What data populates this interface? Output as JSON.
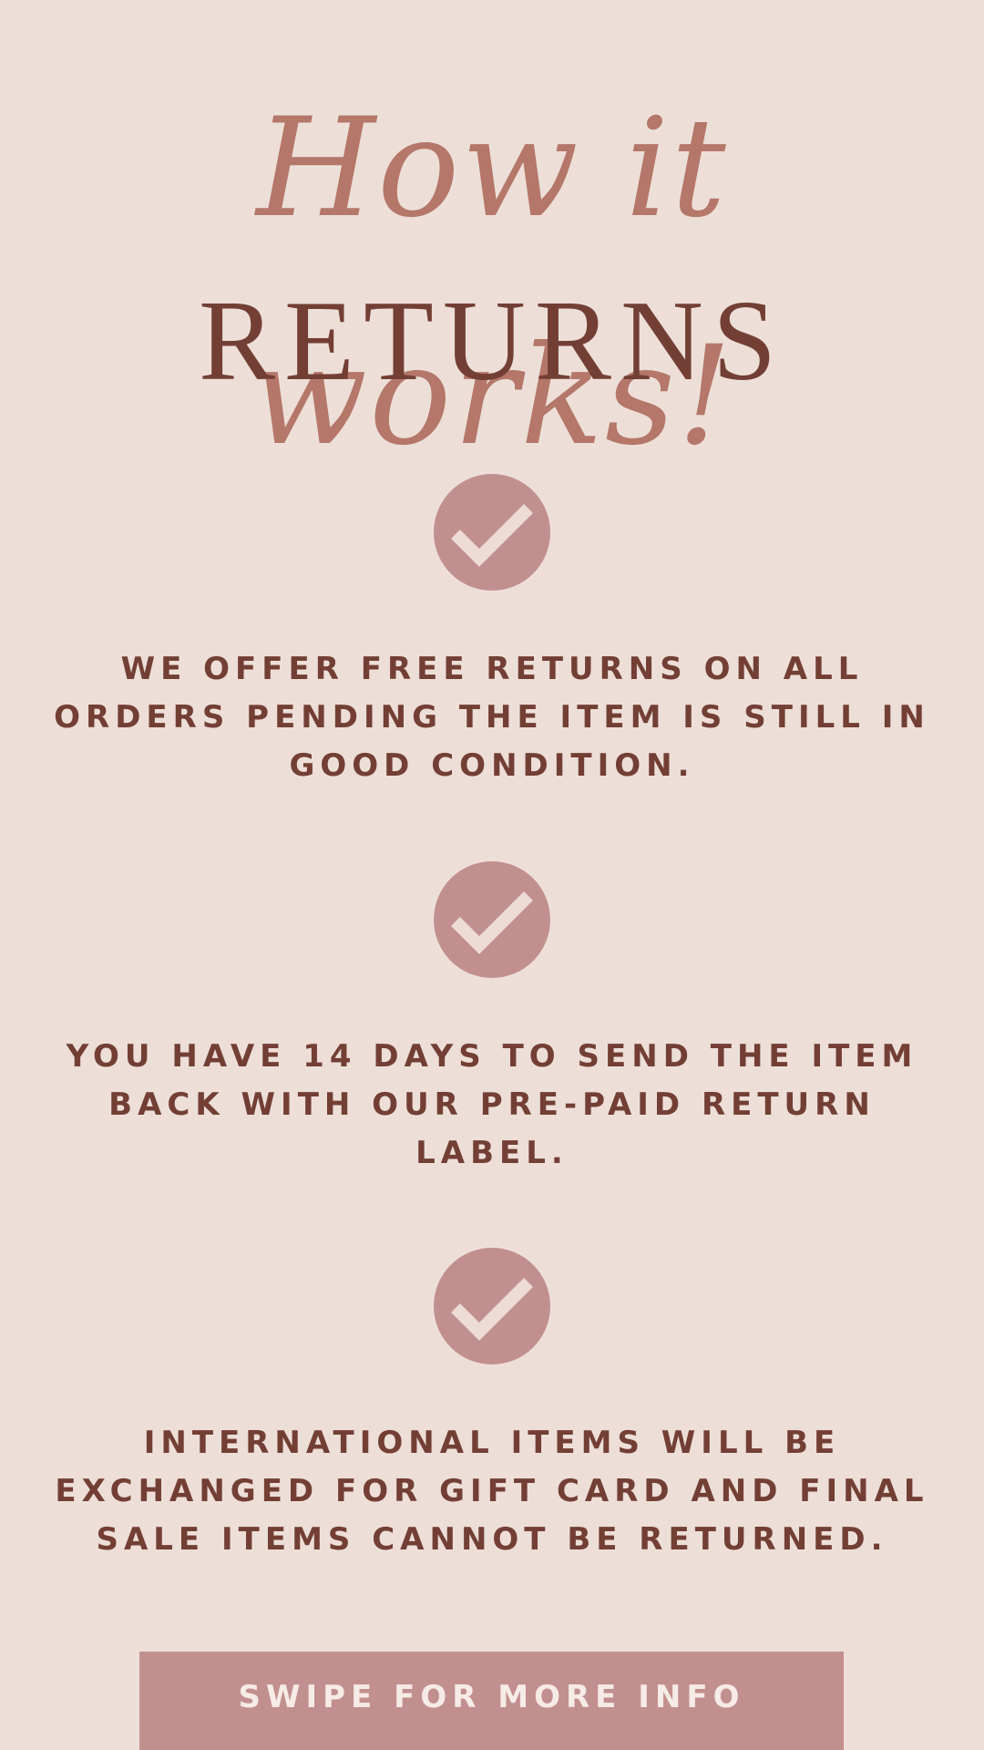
{
  "header": {
    "script_title": "How it works!",
    "title": "RETURNS"
  },
  "icons": {
    "check": "checkmark-circle-icon"
  },
  "statements": [
    {
      "text": "WE OFFER FREE RETURNS ON ALL ORDERS PENDING THE ITEM IS STILL IN GOOD CONDITION."
    },
    {
      "text": "YOU HAVE 14 DAYS TO SEND THE ITEM BACK WITH OUR PRE-PAID RETURN LABEL."
    },
    {
      "text": "INTERNATIONAL ITEMS WILL BE EXCHANGED FOR GIFT CARD AND FINAL SALE ITEMS CANNOT BE RETURNED."
    }
  ],
  "cta": {
    "label": "SWIPE FOR MORE INFO"
  },
  "colors": {
    "background": "#eddfd8",
    "script_accent": "#b4776a",
    "text_brown": "#733f35",
    "rose": "#c28f8f",
    "check_mark": "#ecdcd5"
  }
}
